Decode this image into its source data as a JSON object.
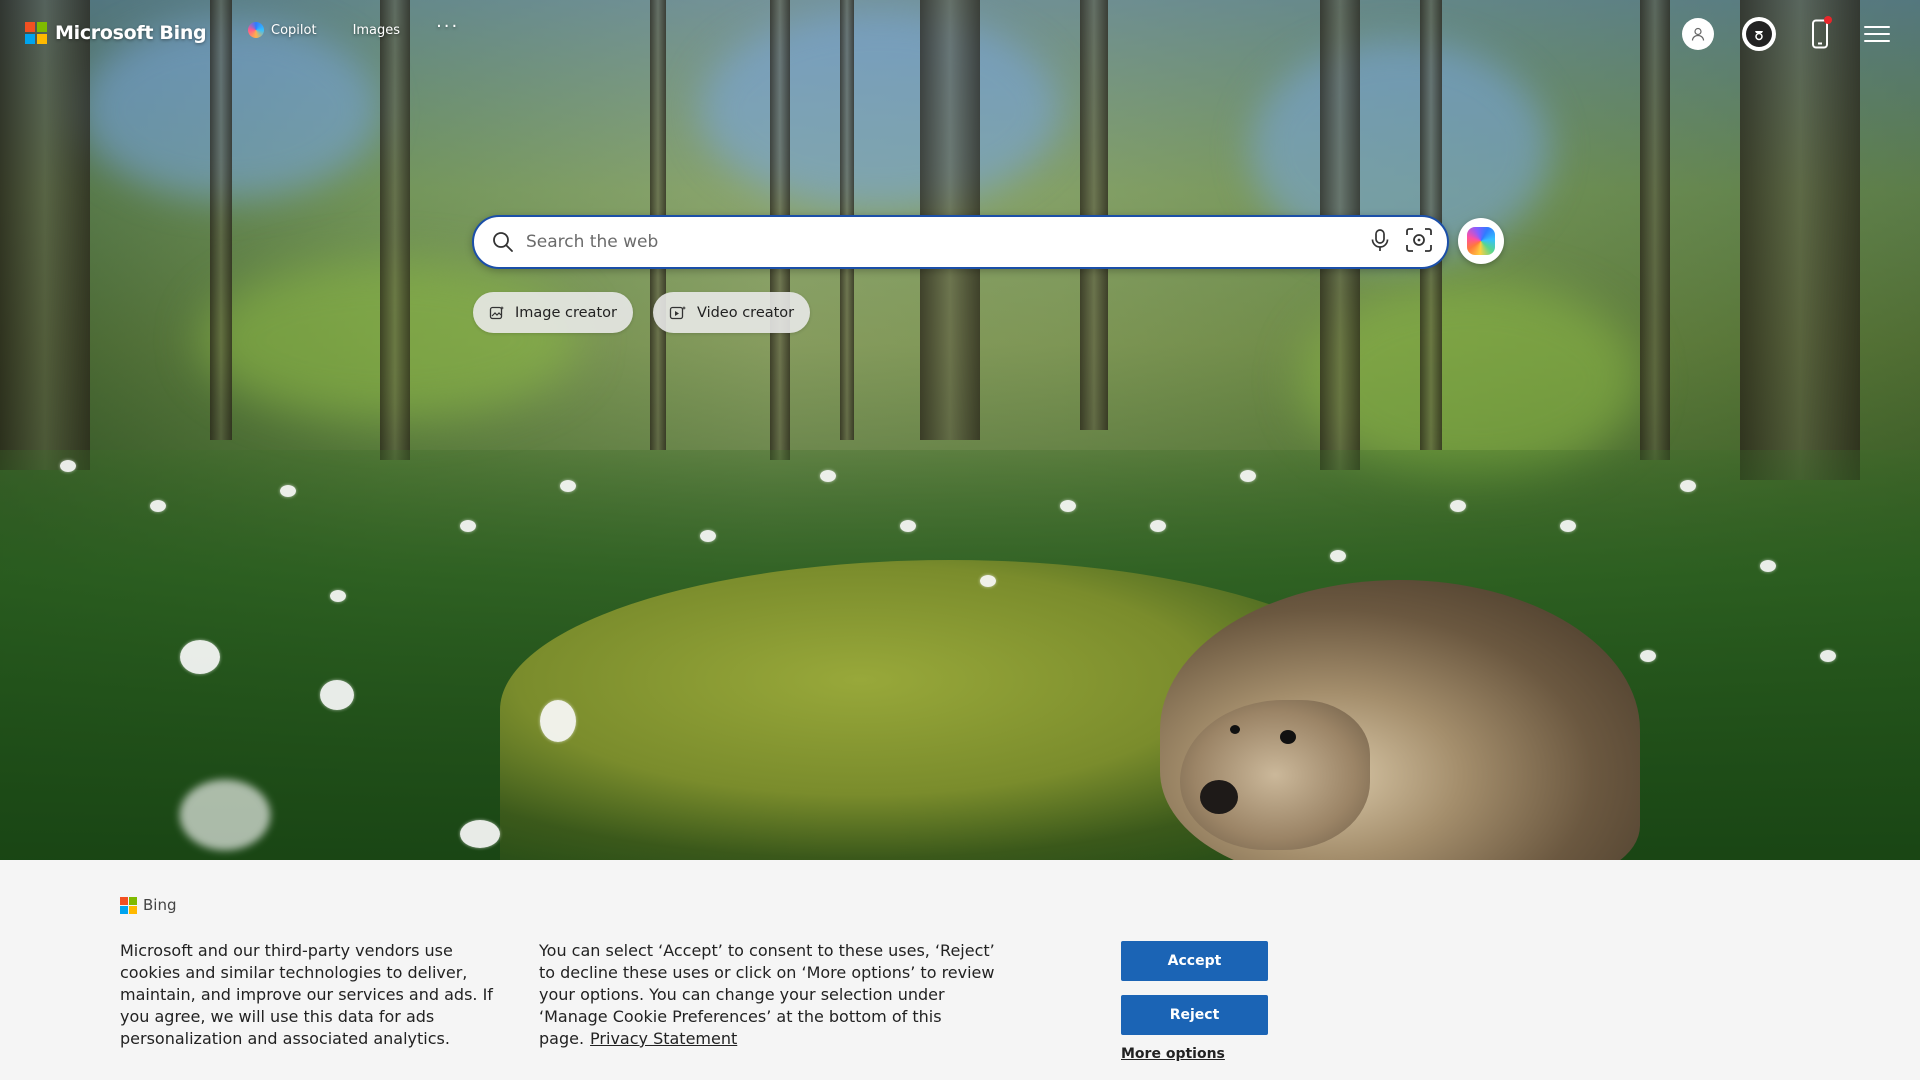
{
  "header": {
    "logo_text": "Microsoft Bing",
    "nav": {
      "copilot": "Copilot",
      "images": "Images",
      "more": "···"
    }
  },
  "search": {
    "placeholder": "Search the web"
  },
  "chips": {
    "image_creator": "Image creator",
    "video_creator": "Video creator"
  },
  "cookie_banner": {
    "brand": "Bing",
    "text_left": "Microsoft and our third-party vendors use cookies and similar technologies to deliver, maintain, and improve our services and ads. If you agree, we will use this data for ads personalization and associated analytics.",
    "text_right": "You can select ‘Accept’ to consent to these uses, ‘Reject’ to decline these uses or click on ‘More options’ to review your options. You can change your selection under ‘Manage Cookie Preferences’ at the bottom of this page.",
    "privacy_link": "Privacy Statement",
    "accept_label": "Accept",
    "reject_label": "Reject",
    "more_options_label": "More options"
  },
  "colors": {
    "accent_blue": "#1b64b5",
    "search_border": "#1b4fa8",
    "notification_dot": "#e8262b"
  }
}
